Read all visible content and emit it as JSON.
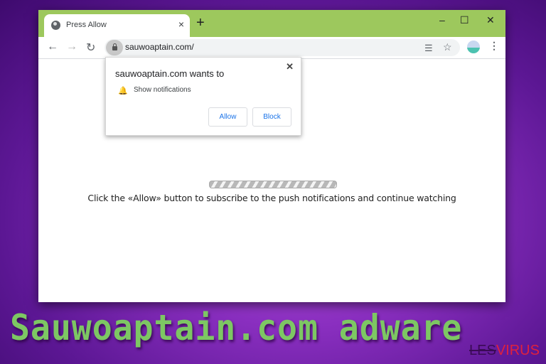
{
  "browser": {
    "tab": {
      "title": "Press Allow",
      "close_glyph": "×",
      "icon": "globe-icon"
    },
    "new_tab_glyph": "+",
    "window_controls": {
      "minimize": "–",
      "maximize": "☐",
      "close": "✕"
    },
    "nav": {
      "back": "←",
      "forward": "→",
      "reload": "↻"
    },
    "address_bar": {
      "url": "sauwoaptain.com/",
      "icon": "lock-icon"
    },
    "toolbar_icons": {
      "reader": "☰",
      "bookmark": "☆",
      "menu": "⋮"
    }
  },
  "permission_popup": {
    "title": "sauwoaptain.com wants to",
    "close_glyph": "✕",
    "bell_glyph": "🔔",
    "permission": "Show notifications",
    "allow_label": "Allow",
    "block_label": "Block"
  },
  "page": {
    "message": "Click the «Allow» button to subscribe to the push notifications and continue watching"
  },
  "overlay": {
    "headline": "Sauwoaptain.com adware",
    "logo_part1": "LES",
    "logo_part2": "VIRUS",
    "headline_color": "#7dc763",
    "logo_color": "#e0213d"
  }
}
